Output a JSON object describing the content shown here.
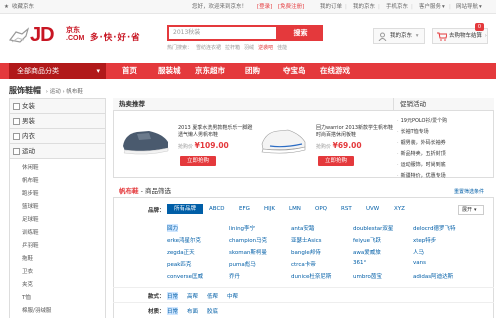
{
  "topbar": {
    "location": "收藏京东",
    "welcome": "您好，欢迎来到京东！",
    "login": "[登录]",
    "register": "[免费注册]",
    "links": [
      "我的订单",
      "我的京东",
      "手机京东",
      "客户服务",
      "网站导航"
    ]
  },
  "header": {
    "logo": "JD",
    "logo_cn": "京东",
    "logo_com": ".COM",
    "slogan": "多·快·好·省",
    "search_value": "2013秋装",
    "search_button": "搜索",
    "hot_label": "热门搜索：",
    "hot_words": [
      "雪纺连衣裙",
      "拉杆箱",
      "羽绒",
      "逆袭吧",
      "佳能"
    ],
    "hot_highlight_index": 3,
    "myjd": "我的京东",
    "cart": "去购物车结算",
    "cart_count": "0"
  },
  "nav": {
    "all_categories": "全部商品分类",
    "links": [
      "首页",
      "服装城",
      "京东超市",
      "团购",
      "夺宝岛",
      "在线游戏"
    ]
  },
  "breadcrumb": {
    "title": "服饰鞋帽",
    "path": [
      "运动",
      "帆布鞋"
    ]
  },
  "sidebar": {
    "sections": [
      "女装",
      "男装",
      "内衣",
      "运动"
    ],
    "sub_items": [
      "休闲鞋",
      "帆布鞋",
      "跑步鞋",
      "篮球鞋",
      "足球鞋",
      "训练鞋",
      "乒羽鞋",
      "拖鞋",
      "卫衣",
      "夹克",
      "T恤",
      "棉服/羽绒服"
    ]
  },
  "hot": {
    "title": "热卖推荐",
    "products": [
      {
        "name": "2013 夏季水洗男款鞋乐乐一脚蹬透气懒人男帆布鞋",
        "price_label": "抢购价",
        "price": "¥109.00",
        "buy": "立即抢购"
      },
      {
        "name": "回力warrior 2013新款学生帆布鞋 时尚百搭休闲板鞋",
        "price_label": "抢购价",
        "price": "¥69.00",
        "buy": "立即抢购"
      }
    ]
  },
  "promotions": {
    "title": "促销活动",
    "items": [
      "19元POLO衫/爱个购",
      "长袖T恤专场",
      "靓男装，外码长袖券",
      "新品特卖，五折封顶",
      "运动服饰，时尚到底",
      "新疆特价，优惠专场"
    ]
  },
  "filter": {
    "category": "帆布鞋",
    "heading": " - 商品筛选",
    "reset": "重置筛选条件",
    "brand_label": "品牌：",
    "all_brands": "所有品牌",
    "letters": [
      "ABCD",
      "EFG",
      "HIJK",
      "LMN",
      "OPQ",
      "RST",
      "UVW",
      "XYZ"
    ],
    "expand": "展开",
    "brands": [
      [
        "回力",
        "lining李宁",
        "anta安踏",
        "doublestar双星",
        "delocrd德罗飞特"
      ],
      [
        "erke鸿星尔克",
        "champion马克",
        "亚瑟士Asics",
        "feiyue飞跃",
        "xtep特步"
      ],
      [
        "zegda正天",
        "skoman斯柯曼",
        "bangle邦侍",
        "awa爱威旅",
        "人马"
      ],
      [
        "peak匹克",
        "puma彪马",
        "ctrca卡帝",
        "361°",
        "vans"
      ],
      [
        "converse匡威",
        "乔丹",
        "dunice杜奈尼斯",
        "umbro茵宝",
        "adidas阿迪达斯"
      ]
    ],
    "style_label": "款式：",
    "styles": [
      "日常",
      "高帮",
      "低帮",
      "中帮"
    ],
    "material_label": "材质：",
    "materials": [
      "日常",
      "布面",
      "胶底"
    ]
  }
}
